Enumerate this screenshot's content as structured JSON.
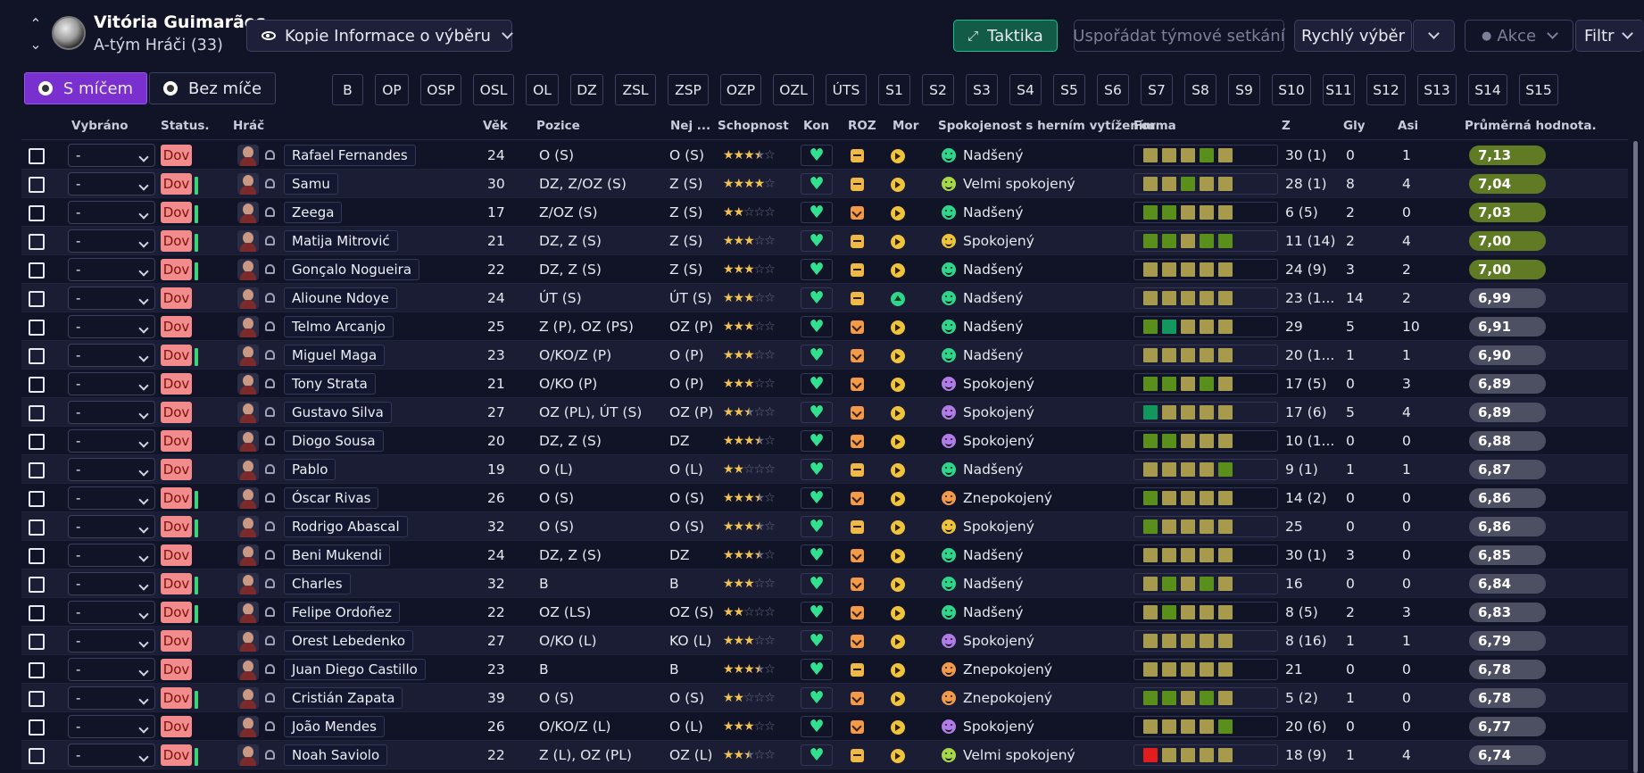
{
  "header": {
    "club": "Vitória Guimarães",
    "squad": "A-tým Hráči (33)",
    "view_button": "Kopie Informace o výběru",
    "tactic_button": "Taktika",
    "arrange_placeholder": "Uspořádat týmové setkání",
    "quick_pick": "Rychlý výběr",
    "actions": "Akce",
    "filter": "Filtr"
  },
  "tabs": {
    "with_ball": "S míčem",
    "without_ball": "Bez míče"
  },
  "positions": [
    "B",
    "OP",
    "OSP",
    "OSL",
    "OL",
    "DZ",
    "ZSL",
    "ZSP",
    "OZP",
    "OZL",
    "ÚTS",
    "S1",
    "S2",
    "S3",
    "S4",
    "S5",
    "S6",
    "S7",
    "S8",
    "S9",
    "S10",
    "S11",
    "S12",
    "S13",
    "S14",
    "S15"
  ],
  "columns": {
    "selected": "Vybráno",
    "status": "Status.",
    "player": "Hráč",
    "age": "Věk",
    "position": "Pozice",
    "best": "Nej ...",
    "ability": "Schopnost",
    "cond": "Kon",
    "roz": "ROZ",
    "morale": "Mor",
    "satisfaction": "Spokojenost s herním vytížením",
    "form": "Forma",
    "apps": "Z",
    "goals": "Gly",
    "assists": "Asi",
    "avg": "Průměrná hodnota."
  },
  "rows": [
    {
      "sel": "-",
      "status": "Dov",
      "bar": false,
      "name": "Rafael Fernandes",
      "age": "24",
      "pos": "O (S)",
      "best": "O (S)",
      "stars": 3.5,
      "roz": "m",
      "mor": "y",
      "face": "f1",
      "sat": "Nadšený",
      "form": [
        "y",
        "y",
        "y",
        "g",
        "y"
      ],
      "apps": "30 (1)",
      "goals": "0",
      "assists": "1",
      "avg": "7,13",
      "ac": "g"
    },
    {
      "sel": "-",
      "status": "Dov",
      "bar": true,
      "name": "Samu",
      "age": "30",
      "pos": "DZ, Z/OZ (S)",
      "best": "Z (S)",
      "stars": 4,
      "roz": "m",
      "mor": "y",
      "face": "f2",
      "sat": "Velmi spokojený",
      "form": [
        "y",
        "y",
        "g",
        "y",
        "y"
      ],
      "apps": "28 (1)",
      "goals": "8",
      "assists": "4",
      "avg": "7,04",
      "ac": "g"
    },
    {
      "sel": "-",
      "status": "Dov",
      "bar": true,
      "name": "Zeega",
      "age": "17",
      "pos": "Z/OZ (S)",
      "best": "Z (S)",
      "stars": 2,
      "roz": "v",
      "mor": "y",
      "face": "f1",
      "sat": "Nadšený",
      "form": [
        "g",
        "g",
        "y",
        "y",
        "y"
      ],
      "apps": "6 (5)",
      "goals": "2",
      "assists": "0",
      "avg": "7,03",
      "ac": "g"
    },
    {
      "sel": "-",
      "status": "Dov",
      "bar": true,
      "name": "Matija Mitrović",
      "age": "21",
      "pos": "DZ, Z (S)",
      "best": "Z (S)",
      "stars": 3,
      "roz": "m",
      "mor": "y",
      "face": "f3",
      "sat": "Spokojený",
      "form": [
        "g",
        "g",
        "y",
        "g",
        "g"
      ],
      "apps": "11 (14)",
      "goals": "2",
      "assists": "4",
      "avg": "7,00",
      "ac": "g"
    },
    {
      "sel": "-",
      "status": "Dov",
      "bar": true,
      "name": "Gonçalo Nogueira",
      "age": "22",
      "pos": "DZ, Z (S)",
      "best": "Z (S)",
      "stars": 3,
      "roz": "m",
      "mor": "y",
      "face": "f1",
      "sat": "Nadšený",
      "form": [
        "y",
        "y",
        "y",
        "y",
        "y"
      ],
      "apps": "24 (9)",
      "goals": "3",
      "assists": "2",
      "avg": "7,00",
      "ac": "g"
    },
    {
      "sel": "-",
      "status": "Dov",
      "bar": false,
      "name": "Alioune Ndoye",
      "age": "24",
      "pos": "ÚT (S)",
      "best": "ÚT (S)",
      "stars": 3,
      "roz": "m",
      "mor": "g",
      "face": "f1",
      "sat": "Nadšený",
      "form": [
        "y",
        "y",
        "y",
        "y",
        "y"
      ],
      "apps": "23 (1...",
      "goals": "14",
      "assists": "2",
      "avg": "6,99",
      "ac": "d"
    },
    {
      "sel": "-",
      "status": "Dov",
      "bar": false,
      "name": "Telmo Arcanjo",
      "age": "25",
      "pos": "Z (P), OZ (PS)",
      "best": "OZ (P)",
      "stars": 3,
      "roz": "v",
      "mor": "y",
      "face": "f1",
      "sat": "Nadšený",
      "form": [
        "g",
        "t",
        "y",
        "y",
        "y"
      ],
      "apps": "29",
      "goals": "5",
      "assists": "10",
      "avg": "6,91",
      "ac": "d"
    },
    {
      "sel": "-",
      "status": "Dov",
      "bar": true,
      "name": "Miguel Maga",
      "age": "23",
      "pos": "O/KO/Z (P)",
      "best": "O (P)",
      "stars": 3,
      "roz": "v",
      "mor": "y",
      "face": "f1",
      "sat": "Nadšený",
      "form": [
        "y",
        "y",
        "y",
        "y",
        "y"
      ],
      "apps": "20 (1...",
      "goals": "1",
      "assists": "1",
      "avg": "6,90",
      "ac": "d"
    },
    {
      "sel": "-",
      "status": "Dov",
      "bar": false,
      "name": "Tony Strata",
      "age": "21",
      "pos": "O/KO (P)",
      "best": "O (P)",
      "stars": 3,
      "roz": "v",
      "mor": "y",
      "face": "f5",
      "sat": "Spokojený",
      "form": [
        "g",
        "g",
        "y",
        "g",
        "y"
      ],
      "apps": "17 (5)",
      "goals": "0",
      "assists": "3",
      "avg": "6,89",
      "ac": "d"
    },
    {
      "sel": "-",
      "status": "Dov",
      "bar": false,
      "name": "Gustavo Silva",
      "age": "27",
      "pos": "OZ (PL), ÚT (S)",
      "best": "OZ (P)",
      "stars": 2.5,
      "roz": "v",
      "mor": "y",
      "face": "f5",
      "sat": "Spokojený",
      "form": [
        "t",
        "y",
        "y",
        "y",
        "y"
      ],
      "apps": "17 (6)",
      "goals": "5",
      "assists": "4",
      "avg": "6,89",
      "ac": "d"
    },
    {
      "sel": "-",
      "status": "Dov",
      "bar": false,
      "name": "Diogo Sousa",
      "age": "20",
      "pos": "DZ, Z (S)",
      "best": "DZ",
      "stars": 3.5,
      "roz": "v",
      "mor": "y",
      "face": "f5",
      "sat": "Spokojený",
      "form": [
        "g",
        "g",
        "y",
        "y",
        "y"
      ],
      "apps": "10 (1...",
      "goals": "0",
      "assists": "0",
      "avg": "6,88",
      "ac": "d"
    },
    {
      "sel": "-",
      "status": "Dov",
      "bar": false,
      "name": "Pablo",
      "age": "19",
      "pos": "O (L)",
      "best": "O (L)",
      "stars": 2,
      "roz": "m",
      "mor": "y",
      "face": "f1",
      "sat": "Nadšený",
      "form": [
        "y",
        "y",
        "y",
        "y",
        "g"
      ],
      "apps": "9 (1)",
      "goals": "1",
      "assists": "1",
      "avg": "6,87",
      "ac": "d"
    },
    {
      "sel": "-",
      "status": "Dov",
      "bar": true,
      "name": "Óscar Rivas",
      "age": "26",
      "pos": "O (S)",
      "best": "O (S)",
      "stars": 3.5,
      "roz": "v",
      "mor": "y",
      "face": "f4",
      "sat": "Znepokojený",
      "form": [
        "g",
        "y",
        "y",
        "y",
        "y"
      ],
      "apps": "14 (2)",
      "goals": "0",
      "assists": "0",
      "avg": "6,86",
      "ac": "d"
    },
    {
      "sel": "-",
      "status": "Dov",
      "bar": true,
      "name": "Rodrigo Abascal",
      "age": "32",
      "pos": "O (S)",
      "best": "O (S)",
      "stars": 3.5,
      "roz": "m",
      "mor": "y",
      "face": "f3",
      "sat": "Spokojený",
      "form": [
        "g",
        "y",
        "y",
        "y",
        "y"
      ],
      "apps": "25",
      "goals": "0",
      "assists": "0",
      "avg": "6,86",
      "ac": "d"
    },
    {
      "sel": "-",
      "status": "Dov",
      "bar": false,
      "name": "Beni Mukendi",
      "age": "24",
      "pos": "DZ, Z (S)",
      "best": "DZ",
      "stars": 3.5,
      "roz": "v",
      "mor": "y",
      "face": "f1",
      "sat": "Nadšený",
      "form": [
        "y",
        "y",
        "y",
        "y",
        "y"
      ],
      "apps": "30 (1)",
      "goals": "3",
      "assists": "0",
      "avg": "6,85",
      "ac": "d"
    },
    {
      "sel": "-",
      "status": "Dov",
      "bar": true,
      "name": "Charles",
      "age": "32",
      "pos": "B",
      "best": "B",
      "stars": 3,
      "roz": "v",
      "mor": "y",
      "face": "f1",
      "sat": "Nadšený",
      "form": [
        "y",
        "g",
        "y",
        "g",
        "y"
      ],
      "apps": "16",
      "goals": "0",
      "assists": "0",
      "avg": "6,84",
      "ac": "d"
    },
    {
      "sel": "-",
      "status": "Dov",
      "bar": true,
      "name": "Felipe Ordoñez",
      "age": "22",
      "pos": "OZ (LS)",
      "best": "OZ (S)",
      "stars": 2,
      "roz": "v",
      "mor": "y",
      "face": "f1",
      "sat": "Nadšený",
      "form": [
        "y",
        "g",
        "y",
        "y",
        "y"
      ],
      "apps": "8 (5)",
      "goals": "2",
      "assists": "3",
      "avg": "6,83",
      "ac": "d"
    },
    {
      "sel": "-",
      "status": "Dov",
      "bar": false,
      "name": "Orest Lebedenko",
      "age": "27",
      "pos": "O/KO (L)",
      "best": "KO (L)",
      "stars": 3,
      "roz": "v",
      "mor": "y",
      "face": "f5",
      "sat": "Spokojený",
      "form": [
        "y",
        "y",
        "y",
        "y",
        "y"
      ],
      "apps": "8 (16)",
      "goals": "1",
      "assists": "1",
      "avg": "6,79",
      "ac": "d"
    },
    {
      "sel": "-",
      "status": "Dov",
      "bar": false,
      "name": "Juan Diego Castillo",
      "age": "23",
      "pos": "B",
      "best": "B",
      "stars": 3.5,
      "roz": "m",
      "mor": "y",
      "face": "f4",
      "sat": "Znepokojený",
      "form": [
        "y",
        "y",
        "y",
        "y",
        "y"
      ],
      "apps": "21",
      "goals": "0",
      "assists": "0",
      "avg": "6,78",
      "ac": "d"
    },
    {
      "sel": "-",
      "status": "Dov",
      "bar": true,
      "name": "Cristián Zapata",
      "age": "39",
      "pos": "O (S)",
      "best": "O (S)",
      "stars": 2,
      "roz": "v",
      "mor": "y",
      "face": "f4",
      "sat": "Znepokojený",
      "form": [
        "g",
        "g",
        "y",
        "g",
        "y"
      ],
      "apps": "5 (2)",
      "goals": "1",
      "assists": "0",
      "avg": "6,78",
      "ac": "d"
    },
    {
      "sel": "-",
      "status": "Dov",
      "bar": false,
      "name": "João Mendes",
      "age": "26",
      "pos": "O/KO/Z (L)",
      "best": "O (L)",
      "stars": 3,
      "roz": "v",
      "mor": "y",
      "face": "f5",
      "sat": "Spokojený",
      "form": [
        "y",
        "y",
        "y",
        "y",
        "g"
      ],
      "apps": "20 (6)",
      "goals": "0",
      "assists": "0",
      "avg": "6,77",
      "ac": "d"
    },
    {
      "sel": "-",
      "status": "Dov",
      "bar": true,
      "name": "Noah Saviolo",
      "age": "22",
      "pos": "Z (L), OZ (PL)",
      "best": "OZ (L)",
      "stars": 2.5,
      "roz": "m",
      "mor": "y",
      "face": "f2",
      "sat": "Velmi spokojený",
      "form": [
        "r",
        "y",
        "y",
        "y",
        "y"
      ],
      "apps": "18 (9)",
      "goals": "1",
      "assists": "4",
      "avg": "6,74",
      "ac": "d"
    }
  ]
}
